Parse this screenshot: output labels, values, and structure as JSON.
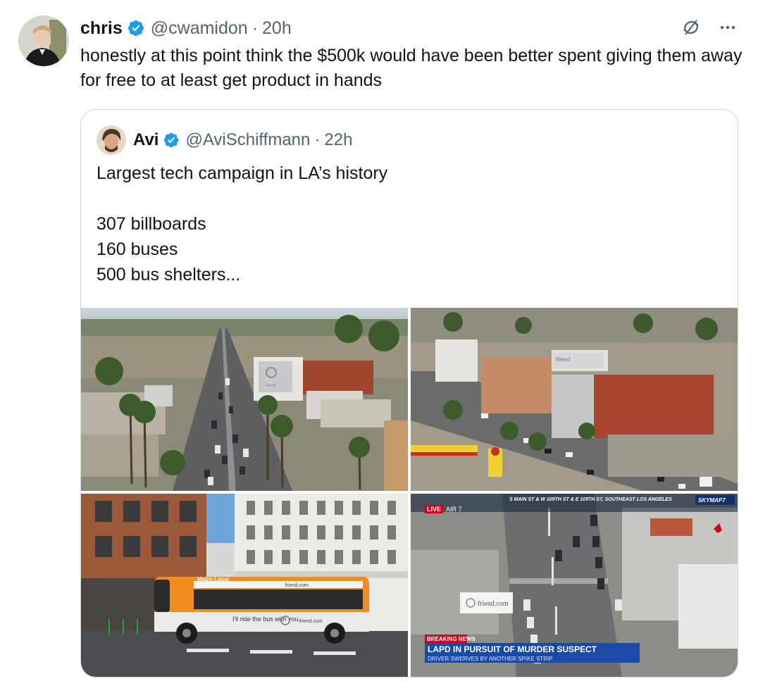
{
  "tweet": {
    "author_name": "chris",
    "handle": "@cwamidon",
    "separator": "·",
    "time": "20h",
    "text": "honestly at this point think the $500k would have been better spent giving them away for free to at least get product in hands"
  },
  "quote": {
    "author_name": "Avi",
    "handle": "@AviSchiffmann",
    "separator": "·",
    "time": "22h",
    "lines": [
      "Largest tech campaign in LA’s history",
      "",
      "307 billboards",
      "160 buses",
      "500 bus shelters..."
    ]
  },
  "media": {
    "billboard1_text": "friend",
    "billboard2_text": "friend",
    "bus_route": "Metro Local",
    "bus_banner": "friend.com",
    "bus_side_text": "I'll ride the bus with you.",
    "bus_side_url": "friend.com",
    "news_live": "LIVE",
    "news_air": "AIR 7",
    "news_location": "S MAIN ST & W 109TH ST & E 109TH ST, SOUTHEAST LOS ANGELES",
    "news_logo": "SKYMAP7",
    "news_breaking": "BREAKING NEWS",
    "news_headline": "LAPD IN PURSUIT OF MURDER SUSPECT",
    "news_subheadline": "DRIVER SWERVES BY ANOTHER SPIKE STRIP",
    "news_billboard": "friend.com"
  },
  "icons": [
    "verified-badge-icon",
    "grok-icon",
    "more-icon"
  ],
  "colors": {
    "verified": "#1d9bf0",
    "text": "#0f1419",
    "secondary": "#536471",
    "border": "#cfd9de",
    "bus_orange": "#f28c1f",
    "news_red": "#d0021b",
    "news_blue": "#1a4aa8"
  }
}
